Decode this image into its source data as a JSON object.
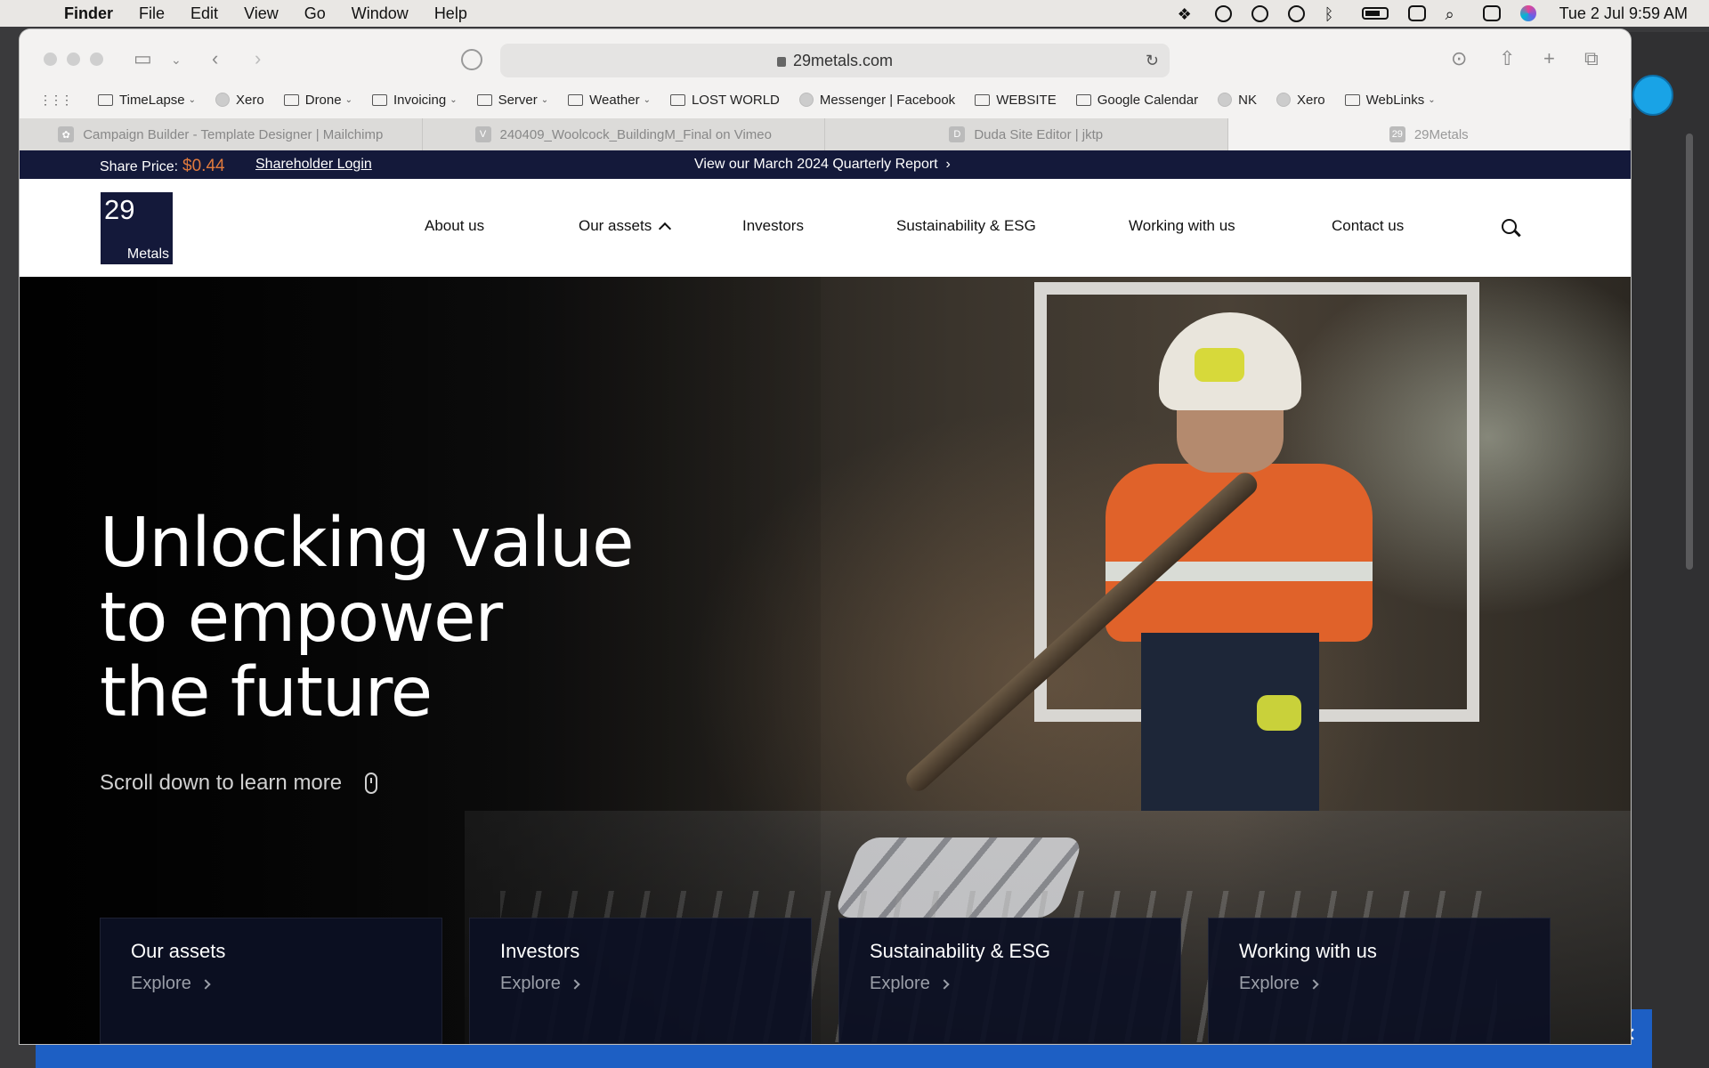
{
  "menubar": {
    "app": "Finder",
    "items": [
      "File",
      "Edit",
      "View",
      "Go",
      "Window",
      "Help"
    ],
    "clock": "Tue 2 Jul  9:59 AM"
  },
  "browser": {
    "url": "29metals.com",
    "bookmarks": [
      {
        "label": "TimeLapse",
        "type": "folder"
      },
      {
        "label": "Xero",
        "type": "site"
      },
      {
        "label": "Drone",
        "type": "folder"
      },
      {
        "label": "Invoicing",
        "type": "folder"
      },
      {
        "label": "Server",
        "type": "folder"
      },
      {
        "label": "Weather",
        "type": "folder"
      },
      {
        "label": "LOST WORLD",
        "type": "site"
      },
      {
        "label": "Messenger | Facebook",
        "type": "site"
      },
      {
        "label": "WEBSITE",
        "type": "site"
      },
      {
        "label": "Google Calendar",
        "type": "site"
      },
      {
        "label": "NK",
        "type": "site"
      },
      {
        "label": "Xero",
        "type": "site"
      },
      {
        "label": "WebLinks",
        "type": "folder"
      }
    ],
    "tabs": [
      {
        "label": "Campaign Builder - Template Designer | Mailchimp",
        "active": false
      },
      {
        "label": "240409_Woolcock_BuildingM_Final on Vimeo",
        "active": false
      },
      {
        "label": "Duda Site Editor | jktp",
        "active": false
      },
      {
        "label": "29Metals",
        "active": true
      }
    ]
  },
  "site": {
    "share_label": "Share Price:",
    "share_price": "$0.44",
    "shareholder_login": "Shareholder Login",
    "report_link": "View our March 2024 Quarterly Report",
    "logo_number": "29",
    "logo_word": "Metals",
    "nav": [
      "About us",
      "Our assets",
      "Investors",
      "Sustainability & ESG",
      "Working with us",
      "Contact us"
    ],
    "headline_lines": [
      "Unlocking value",
      "to empower",
      "the future"
    ],
    "scroll_text": "Scroll down to learn more",
    "cards": [
      {
        "title": "Our assets",
        "link": "Explore"
      },
      {
        "title": "Investors",
        "link": "Explore"
      },
      {
        "title": "Sustainability & ESG",
        "link": "Explore"
      },
      {
        "title": "Working with us",
        "link": "Explore"
      }
    ]
  },
  "colors": {
    "navy": "#14193a",
    "price_orange": "#e07a3d",
    "banner_blue": "#1d5fc4"
  }
}
